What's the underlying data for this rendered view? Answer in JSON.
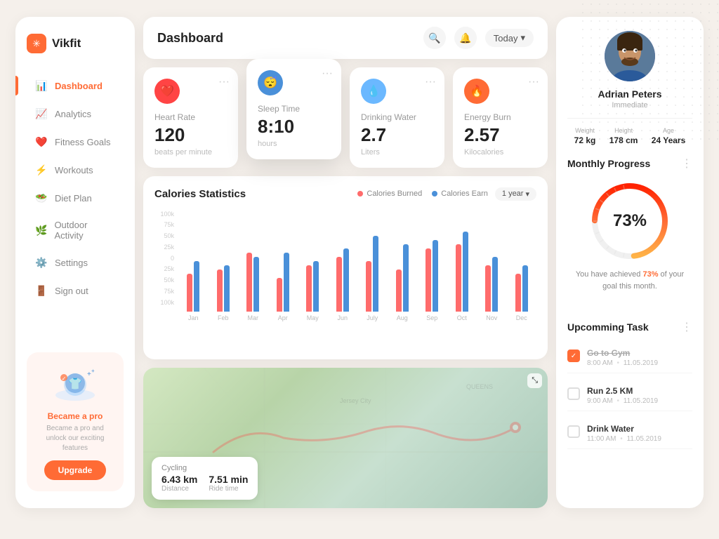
{
  "app": {
    "name": "Vikfit"
  },
  "sidebar": {
    "nav_items": [
      {
        "id": "dashboard",
        "label": "Dashboard",
        "icon": "📊",
        "active": true
      },
      {
        "id": "analytics",
        "label": "Analytics",
        "icon": "📈",
        "active": false
      },
      {
        "id": "fitness",
        "label": "Fitness Goals",
        "icon": "❤️",
        "active": false
      },
      {
        "id": "workouts",
        "label": "Workouts",
        "icon": "⚡",
        "active": false
      },
      {
        "id": "diet",
        "label": "Diet Plan",
        "icon": "🥗",
        "active": false
      },
      {
        "id": "outdoor",
        "label": "Outdoor Activity",
        "icon": "🌿",
        "active": false
      },
      {
        "id": "settings",
        "label": "Settings",
        "icon": "⚙️",
        "active": false
      },
      {
        "id": "signout",
        "label": "Sign out",
        "icon": "🚪",
        "active": false
      }
    ],
    "upgrade": {
      "title": "Became a pro",
      "desc": "Became a pro and unlock our exciting features",
      "btn_label": "Upgrade"
    }
  },
  "header": {
    "title": "Dashboard",
    "filter": "Today"
  },
  "stats": [
    {
      "id": "heart-rate",
      "name": "Heart Rate",
      "value": "120",
      "unit": "beats per minute",
      "icon": "❤️",
      "icon_style": "red"
    },
    {
      "id": "sleep-time",
      "name": "Sleep Time",
      "value": "8:10",
      "unit": "hours",
      "icon": "😴",
      "icon_style": "blue",
      "elevated": true
    },
    {
      "id": "drinking-water",
      "name": "Drinking Water",
      "value": "2.7",
      "unit": "Liters",
      "icon": "💧",
      "icon_style": "light-blue"
    },
    {
      "id": "energy-burn",
      "name": "Energy Burn",
      "value": "2.57",
      "unit": "Kilocalories",
      "icon": "🔥",
      "icon_style": "orange"
    }
  ],
  "calories_chart": {
    "title": "Calories Statistics",
    "legend": {
      "burned": "Calories Burned",
      "earned": "Calories Earn"
    },
    "filter": "1 year",
    "y_axis": [
      "100k",
      "75k",
      "50k",
      "25k",
      "0",
      "25k",
      "50k",
      "75k",
      "100k"
    ],
    "months": [
      "Jan",
      "Feb",
      "Mar",
      "Apr",
      "May",
      "Jun",
      "July",
      "Aug",
      "Sep",
      "Oct",
      "Nov",
      "Dec"
    ],
    "data": [
      {
        "month": "Jan",
        "burned": 45,
        "earned": 60
      },
      {
        "month": "Feb",
        "burned": 50,
        "earned": 55
      },
      {
        "month": "Mar",
        "burned": 70,
        "earned": 65
      },
      {
        "month": "Apr",
        "burned": 40,
        "earned": 70
      },
      {
        "month": "May",
        "burned": 55,
        "earned": 60
      },
      {
        "month": "Jun",
        "burned": 65,
        "earned": 75
      },
      {
        "month": "July",
        "burned": 60,
        "earned": 90
      },
      {
        "month": "Aug",
        "burned": 50,
        "earned": 80
      },
      {
        "month": "Sep",
        "burned": 75,
        "earned": 85
      },
      {
        "month": "Oct",
        "burned": 80,
        "earned": 95
      },
      {
        "month": "Nov",
        "burned": 55,
        "earned": 65
      },
      {
        "month": "Dec",
        "burned": 45,
        "earned": 55
      }
    ]
  },
  "map": {
    "activity": "Cycling",
    "distance_val": "6.43 km",
    "distance_label": "Distance",
    "pace_val": "7.51 min",
    "pace_label": "Ride time"
  },
  "profile": {
    "name": "Adrian Peters",
    "status": "Immediate",
    "weight": "72 kg",
    "height": "178 cm",
    "age": "24 Years",
    "weight_label": "Weight",
    "height_label": "Height",
    "age_label": "Age"
  },
  "monthly_progress": {
    "title": "Monthly Progress",
    "percent": 73,
    "desc_prefix": "You have achieved ",
    "desc_percent": "73%",
    "desc_suffix": " of your goal this month."
  },
  "tasks": {
    "title": "Upcomming Task",
    "items": [
      {
        "id": "gym",
        "name": "Go to Gym",
        "time": "8:00 AM",
        "date": "11.05.2019",
        "done": true
      },
      {
        "id": "run",
        "name": "Run 2.5 KM",
        "time": "9:00 AM",
        "date": "11.05.2019",
        "done": false
      },
      {
        "id": "water",
        "name": "Drink Water",
        "time": "11:00 AM",
        "date": "11.05.2019",
        "done": false
      }
    ]
  }
}
